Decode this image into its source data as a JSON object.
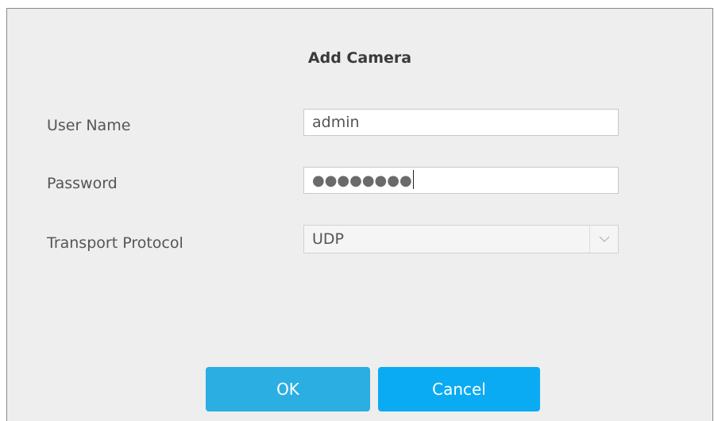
{
  "dialog": {
    "title": "Add Camera",
    "fields": {
      "username": {
        "label": "User Name",
        "value": "admin"
      },
      "password": {
        "label": "Password",
        "masked_value": "●●●●●●●●"
      },
      "transport": {
        "label": "Transport Protocol",
        "value": "UDP"
      }
    },
    "buttons": {
      "ok": "OK",
      "cancel": "Cancel"
    }
  },
  "colors": {
    "dialog_bg": "#eeeeee",
    "button_primary": "#17aae9"
  },
  "icons": {
    "select_arrow": "chevron-down-icon"
  }
}
